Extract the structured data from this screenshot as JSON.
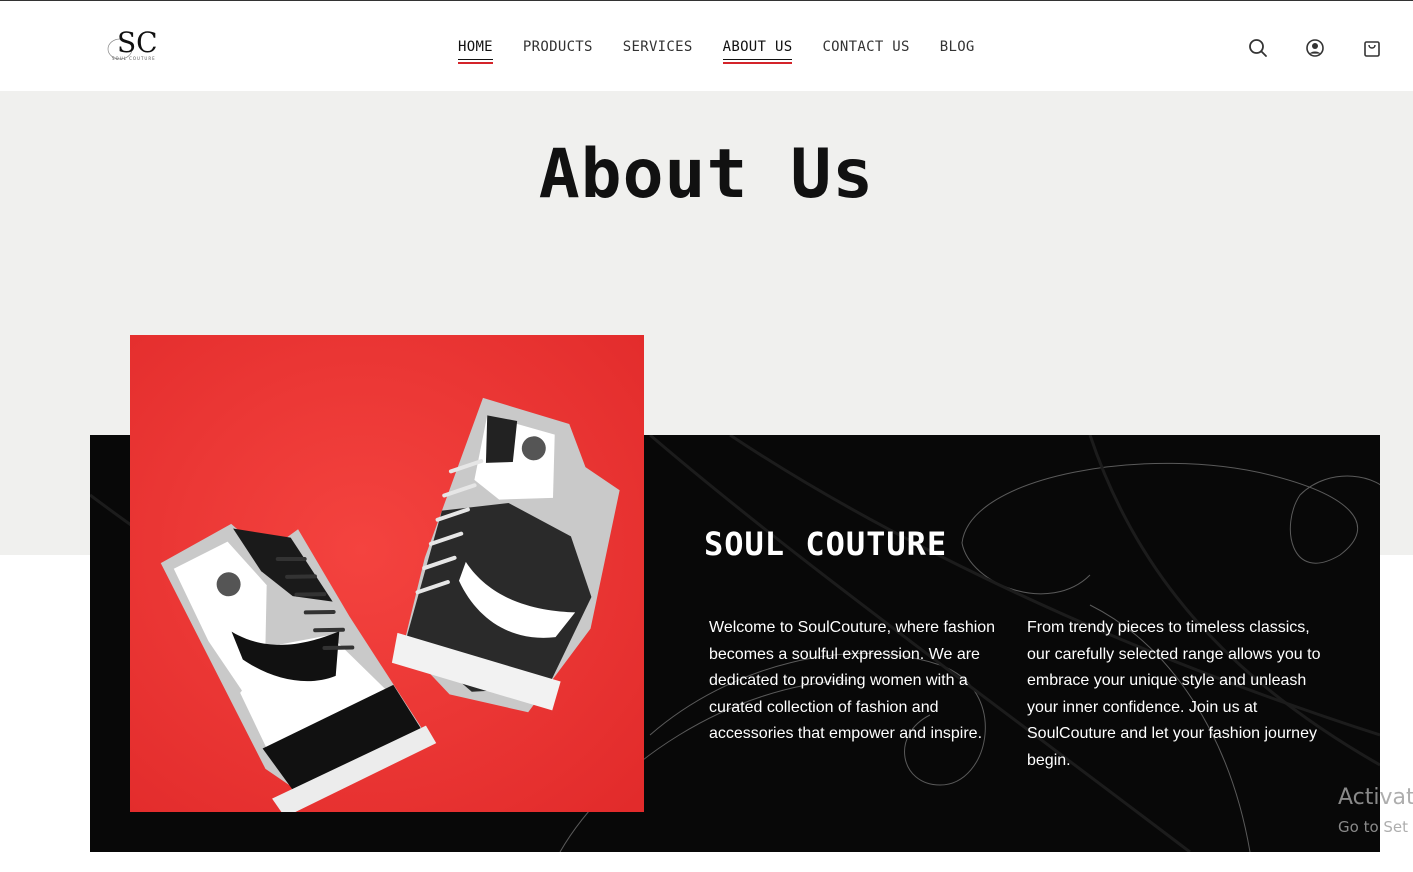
{
  "brand_logo": {
    "monogram": "SC",
    "tagline": "SOUL COUTURE"
  },
  "nav": {
    "items": [
      {
        "label": "HOME",
        "active": true
      },
      {
        "label": "PRODUCTS",
        "active": false
      },
      {
        "label": "SERVICES",
        "active": false
      },
      {
        "label": "ABOUT US",
        "active": true
      },
      {
        "label": "CONTACT US",
        "active": false
      },
      {
        "label": "BLOG",
        "active": false
      }
    ]
  },
  "header_icons": [
    "search-icon",
    "account-icon",
    "shopping-bag-icon"
  ],
  "hero": {
    "title": "About Us"
  },
  "about": {
    "heading": "SOUL COUTURE",
    "paragraph_1": "Welcome to SoulCouture, where fashion becomes a soulful expression. We are dedicated to providing women with a curated collection of fashion and accessories that empower and inspire.",
    "paragraph_2": "From trendy pieces to timeless classics, our carefully selected range allows you to embrace your unique style and unleash your inner confidence. Join us at SoulCouture and let your fashion journey begin."
  },
  "watermark": {
    "line1": "Activat",
    "line2": "Go to Set"
  },
  "colors": {
    "accent": "#d4242a",
    "hero_bg": "#f0f0ee",
    "card_bg": "#080808",
    "photo_bg": "#ee3b3b"
  }
}
